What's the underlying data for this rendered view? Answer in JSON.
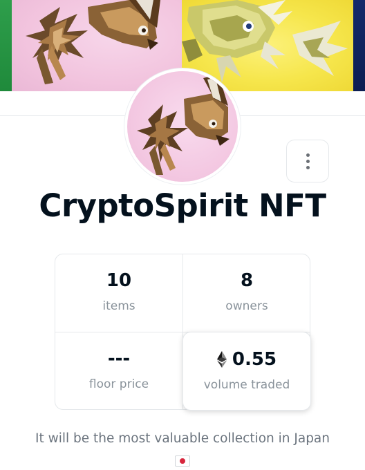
{
  "banner": {
    "images": [
      "green-art",
      "pink-rabbit-art",
      "yellow-fish-art",
      "navy-art"
    ]
  },
  "collection": {
    "title": "CryptoSpirit NFT",
    "avatar_image": "rabbit-spirit-art"
  },
  "actions": {
    "more_icon": "more-vertical-icon"
  },
  "stats": [
    {
      "value": "10",
      "label": "items"
    },
    {
      "value": "8",
      "label": "owners"
    },
    {
      "value": "---",
      "label": "floor price"
    },
    {
      "value": "0.55",
      "label": "volume traded",
      "icon": "eth-icon"
    }
  ],
  "description": {
    "text": "It will be the most valuable collection in Japan",
    "emoji": "japan-flag-icon"
  },
  "colors": {
    "text_primary": "#04111d",
    "text_secondary": "#8a939b",
    "border": "#e5e8eb"
  }
}
